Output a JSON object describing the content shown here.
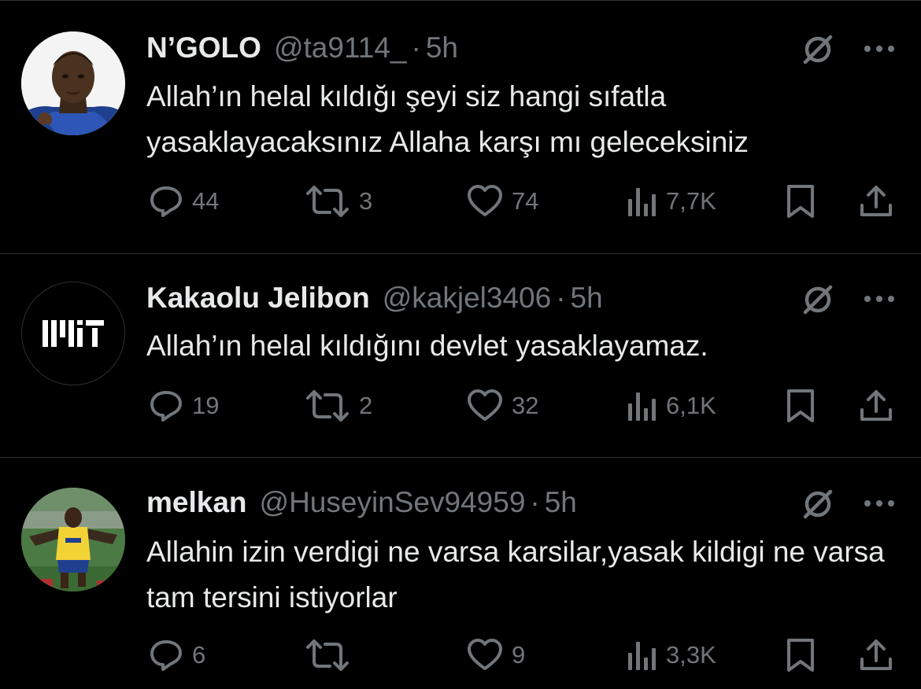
{
  "colors": {
    "background": "#000000",
    "primary_text": "#e7e9ea",
    "secondary_text": "#71767b",
    "divider": "#2f3336"
  },
  "tweets": [
    {
      "author_name": "N’GOLO",
      "handle": "@ta9114_",
      "separator": "·",
      "time": "5h",
      "text": "Allah’ın helal kıldığı şeyi siz hangi sıfatla yasaklayacaksınız Allaha karşı mı geleceksiniz",
      "avatar_icon": "player-photo-avatar",
      "replies": "44",
      "reposts": "3",
      "likes": "74",
      "views": "7,7K"
    },
    {
      "author_name": "Kakaolu Jelibon",
      "handle": "@kakjel3406",
      "separator": "·",
      "time": "5h",
      "text": "Allah’ın helal kıldığını devlet yasaklayamaz.",
      "avatar_icon": "mit-logo-avatar",
      "replies": "19",
      "reposts": "2",
      "likes": "32",
      "views": "6,1K"
    },
    {
      "author_name": "melkan",
      "handle": "@HuseyinSev94959",
      "separator": "·",
      "time": "5h",
      "text": "Allahin izin verdigi ne varsa karsilar,yasak kildigi ne varsa tam tersini istiyorlar",
      "avatar_icon": "footballer-photo-avatar",
      "replies": "6",
      "reposts": "",
      "likes": "9",
      "views": "3,3K"
    }
  ]
}
